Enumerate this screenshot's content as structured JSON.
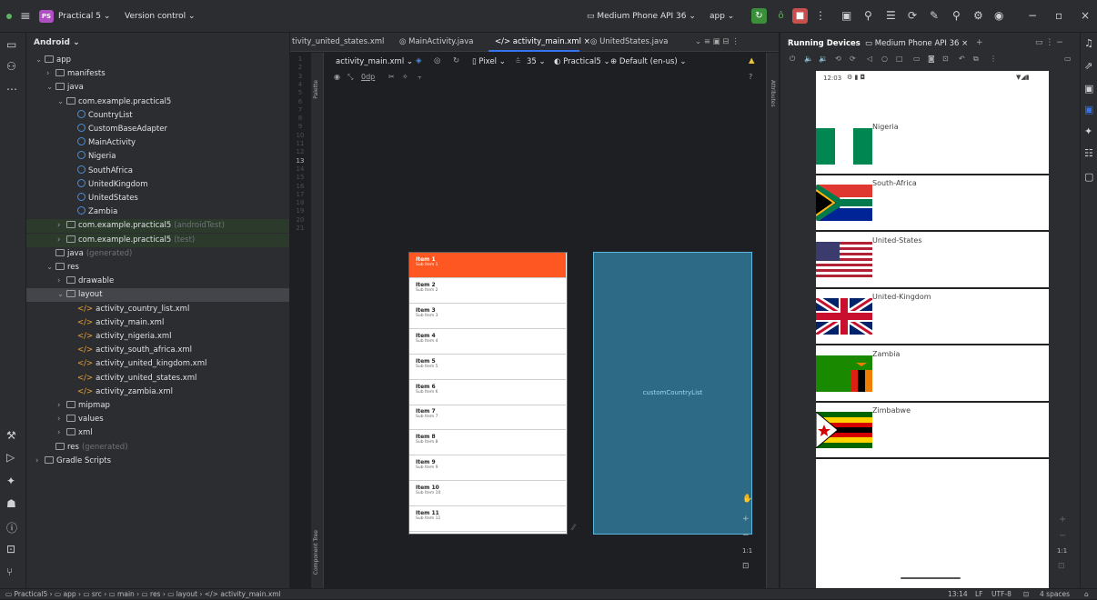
{
  "topbar": {
    "project_badge": "PS",
    "project_name": "Practical 5 ⌄",
    "version_control": "Version control ⌄",
    "device": "▭ Medium Phone API 36 ⌄",
    "run_config": "app ⌄"
  },
  "project_panel": {
    "header": "Android ⌄",
    "tree": [
      {
        "label": "app",
        "indent": 0,
        "icon": "folder",
        "arrow": "⌄"
      },
      {
        "label": "manifests",
        "indent": 1,
        "icon": "folder",
        "arrow": "›"
      },
      {
        "label": "java",
        "indent": 1,
        "icon": "folder",
        "arrow": "⌄"
      },
      {
        "label": "com.example.practical5",
        "indent": 2,
        "icon": "folder",
        "arrow": "⌄"
      },
      {
        "label": "CountryList",
        "indent": 3,
        "icon": "class"
      },
      {
        "label": "CustomBaseAdapter",
        "indent": 3,
        "icon": "class"
      },
      {
        "label": "MainActivity",
        "indent": 3,
        "icon": "class"
      },
      {
        "label": "Nigeria",
        "indent": 3,
        "icon": "class"
      },
      {
        "label": "SouthAfrica",
        "indent": 3,
        "icon": "class"
      },
      {
        "label": "UnitedKingdom",
        "indent": 3,
        "icon": "class"
      },
      {
        "label": "UnitedStates",
        "indent": 3,
        "icon": "class"
      },
      {
        "label": "Zambia",
        "indent": 3,
        "icon": "class"
      },
      {
        "label": "com.example.practical5",
        "suffix": "(androidTest)",
        "indent": 2,
        "icon": "folder",
        "arrow": "›",
        "style": "test"
      },
      {
        "label": "com.example.practical5",
        "suffix": "(test)",
        "indent": 2,
        "icon": "folder",
        "arrow": "›",
        "style": "test"
      },
      {
        "label": "java",
        "suffix": "(generated)",
        "indent": 1,
        "icon": "folder"
      },
      {
        "label": "res",
        "indent": 1,
        "icon": "folder",
        "arrow": "⌄"
      },
      {
        "label": "drawable",
        "indent": 2,
        "icon": "folder",
        "arrow": "›"
      },
      {
        "label": "layout",
        "indent": 2,
        "icon": "folder",
        "arrow": "⌄",
        "style": "sel"
      },
      {
        "label": "activity_country_list.xml",
        "indent": 3,
        "icon": "xml"
      },
      {
        "label": "activity_main.xml",
        "indent": 3,
        "icon": "xml"
      },
      {
        "label": "activity_nigeria.xml",
        "indent": 3,
        "icon": "xml"
      },
      {
        "label": "activity_south_africa.xml",
        "indent": 3,
        "icon": "xml"
      },
      {
        "label": "activity_united_kingdom.xml",
        "indent": 3,
        "icon": "xml"
      },
      {
        "label": "activity_united_states.xml",
        "indent": 3,
        "icon": "xml"
      },
      {
        "label": "activity_zambia.xml",
        "indent": 3,
        "icon": "xml"
      },
      {
        "label": "mipmap",
        "indent": 2,
        "icon": "folder",
        "arrow": "›"
      },
      {
        "label": "values",
        "indent": 2,
        "icon": "folder",
        "arrow": "›"
      },
      {
        "label": "xml",
        "indent": 2,
        "icon": "folder",
        "arrow": "›"
      },
      {
        "label": "res",
        "suffix": "(generated)",
        "indent": 1,
        "icon": "folder"
      },
      {
        "label": "Gradle Scripts",
        "indent": 0,
        "icon": "gradle",
        "arrow": "›"
      }
    ]
  },
  "editor": {
    "tabs": [
      {
        "label": "tivity_united_states.xml",
        "active": false
      },
      {
        "label": "◎ MainActivity.java",
        "active": false
      },
      {
        "label": "</> activity_main.xml ×",
        "active": true
      },
      {
        "label": "◎ UnitedStates.java",
        "active": false
      }
    ],
    "line_numbers": [
      "1",
      "2",
      "3",
      "4",
      "5",
      "6",
      "7",
      "8",
      "9",
      "10",
      "11",
      "12",
      "13",
      "14",
      "15",
      "16",
      "17",
      "18",
      "19",
      "20",
      "21"
    ],
    "palette_label": "Palette",
    "component_tree_label": "Component Tree",
    "attributes_label": "Attributes",
    "design_toolbar": {
      "file": "activity_main.xml ⌄",
      "device": "▯ Pixel ⌄",
      "api": "35 ⌄",
      "theme": "◐ Practical5 ⌄",
      "locale": "⊕ Default (en-us) ⌄"
    },
    "margin_value": "0dp",
    "list_items": [
      {
        "title": "Item 1",
        "sub": "Sub Item 1"
      },
      {
        "title": "Item 2",
        "sub": "Sub Item 2"
      },
      {
        "title": "Item 3",
        "sub": "Sub Item 3"
      },
      {
        "title": "Item 4",
        "sub": "Sub Item 4"
      },
      {
        "title": "Item 5",
        "sub": "Sub Item 5"
      },
      {
        "title": "Item 6",
        "sub": "Sub Item 6"
      },
      {
        "title": "Item 7",
        "sub": "Sub Item 7"
      },
      {
        "title": "Item 8",
        "sub": "Sub Item 8"
      },
      {
        "title": "Item 9",
        "sub": "Sub Item 9"
      },
      {
        "title": "Item 10",
        "sub": "Sub Item 10"
      },
      {
        "title": "Item 11",
        "sub": "Sub Item 11"
      }
    ],
    "blueprint_label": "customCountryList",
    "zoom_ratio": "1:1"
  },
  "running_devices": {
    "header": "Running Devices",
    "device_tab": "▭ Medium Phone API 36 ×",
    "status_time": "12:03",
    "countries": [
      {
        "name": "Nigeria",
        "flag": "nigeria-flag"
      },
      {
        "name": "South-Africa",
        "flag": "south-africa-flag"
      },
      {
        "name": "United-States",
        "flag": "usa-flag"
      },
      {
        "name": "United-Kingdom",
        "flag": "uk-flag"
      },
      {
        "name": "Zambia",
        "flag": "zambia-flag"
      },
      {
        "name": "Zimbabwe",
        "flag": "zimbabwe-flag"
      }
    ],
    "zoom_ratio": "1:1"
  },
  "statusbar": {
    "breadcrumb": "▭ Practical5 › ▭ app › ▭ src › ▭ main › ▭ res › ▭ layout › </> activity_main.xml",
    "position": "13:14",
    "line_sep": "LF",
    "encoding": "UTF-8",
    "indent": "4 spaces"
  },
  "colors": {
    "highlight_item": "#ff5722",
    "blueprint": "#2d6a86",
    "accent": "#3574f0"
  }
}
